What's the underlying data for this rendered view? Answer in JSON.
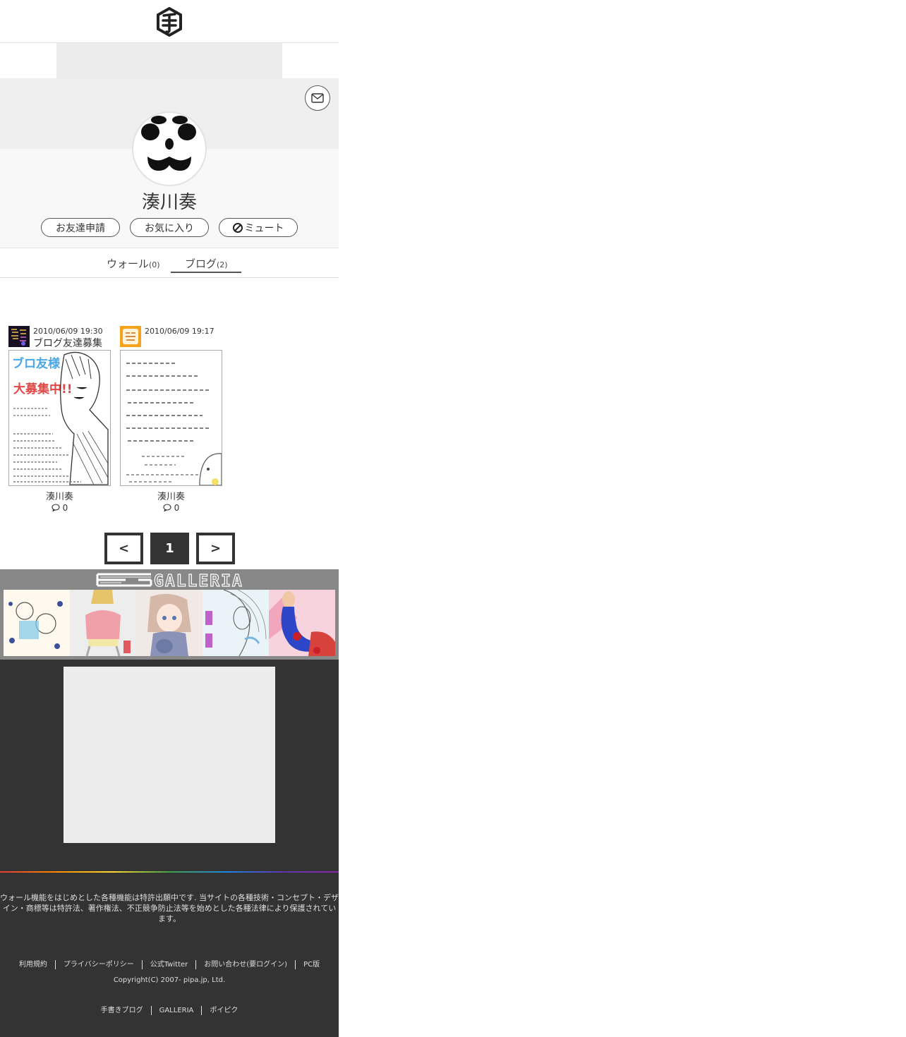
{
  "header": {
    "logo_icon": "te-hexagon-logo"
  },
  "profile": {
    "name": "湊川奏",
    "buttons": {
      "friend_request": "お友達申請",
      "favorite": "お気に入り",
      "mute": "ミュート"
    }
  },
  "tabs": [
    {
      "label": "ウォール",
      "count": "(0)"
    },
    {
      "label": "ブログ",
      "count": "(2)"
    }
  ],
  "posts": [
    {
      "date": "2010/06/09 19:30",
      "title": "ブログ友達募集",
      "author": "湊川奏",
      "comments": "0"
    },
    {
      "date": "2010/06/09 19:17",
      "title": "",
      "author": "湊川奏",
      "comments": "0"
    }
  ],
  "pagination": {
    "prev": "<",
    "current": "1",
    "next": ">"
  },
  "galleria": {
    "logo_text": "GALLERIA"
  },
  "footer": {
    "notice": "ウォール機能をはじめとした各種機能は特許出願中です. 当サイトの各種技術・コンセプト・デザイン・商標等は特許法、著作権法、不正競争防止法等を始めとした各種法律により保護されています。",
    "links": [
      "利用規約",
      "プライバシーポリシー",
      "公式Twitter",
      "お問い合わせ(要ログイン)",
      "PC版"
    ],
    "copyright": "Copyright(C) 2007- pipa.jp, Ltd.",
    "sub_links": [
      "手書きブログ",
      "GALLERIA",
      "ポイピク"
    ]
  }
}
